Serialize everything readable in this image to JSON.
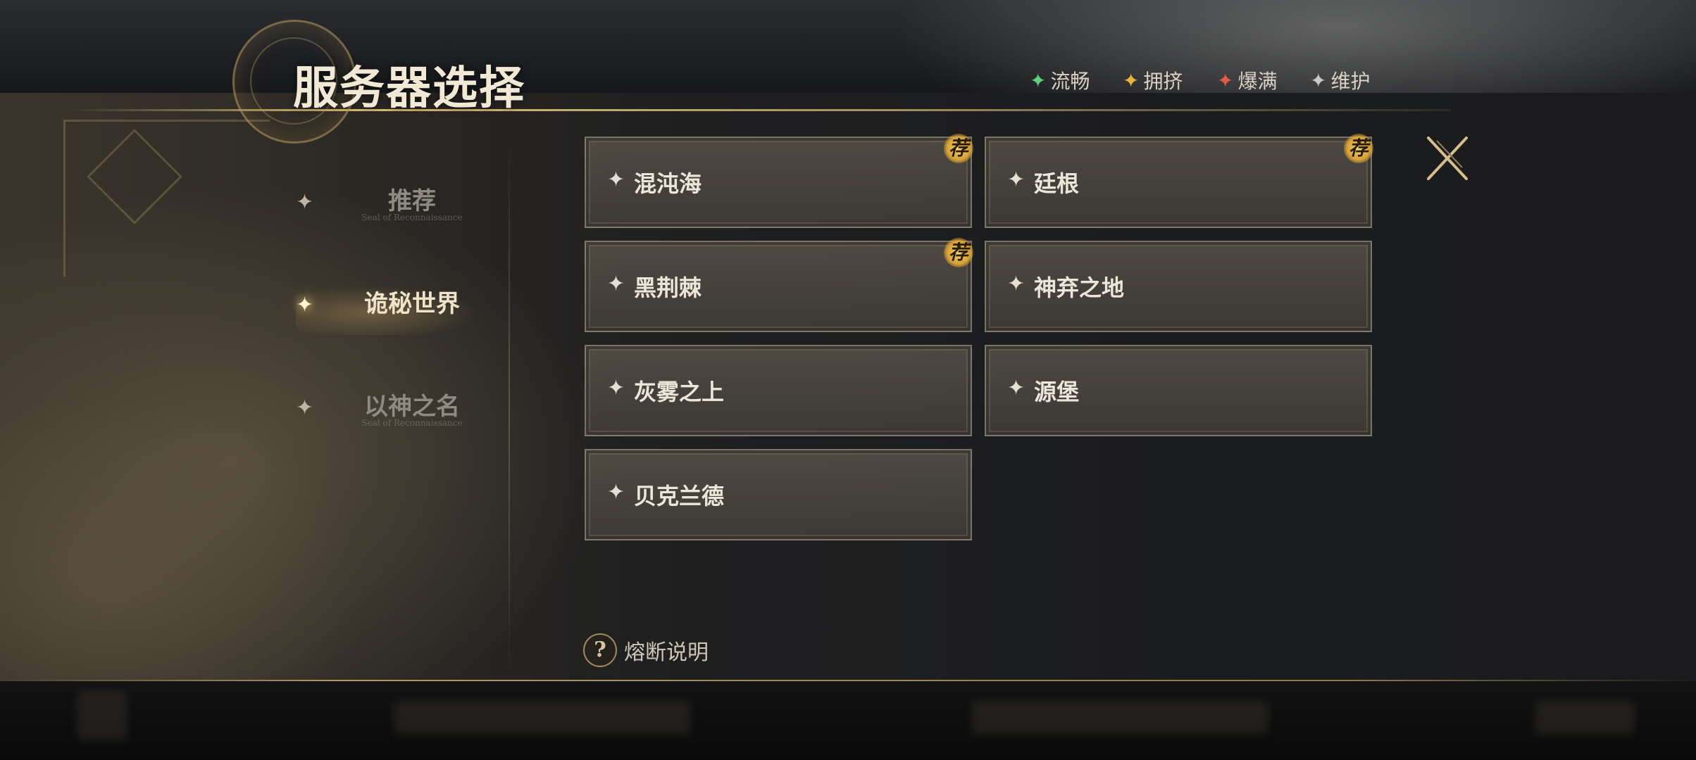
{
  "header": {
    "title": "服务器选择"
  },
  "legend": [
    {
      "label": "流畅",
      "color": "#5fd07a",
      "icon": "star-icon"
    },
    {
      "label": "拥挤",
      "color": "#e8b43d",
      "icon": "star-icon"
    },
    {
      "label": "爆满",
      "color": "#e25a4a",
      "icon": "star-icon"
    },
    {
      "label": "维护",
      "color": "#c8c8c8",
      "icon": "star-icon"
    }
  ],
  "categories": [
    {
      "label": "推荐",
      "sub": "Seal of Reconnaissance",
      "active": false
    },
    {
      "label": "诡秘世界",
      "sub": "",
      "active": true
    },
    {
      "label": "以神之名",
      "sub": "Seal of Reconnaissance",
      "active": false
    }
  ],
  "servers": [
    {
      "name": "混沌海",
      "recommended": true,
      "badge": "荐"
    },
    {
      "name": "廷根",
      "recommended": true,
      "badge": "荐"
    },
    {
      "name": "黑荆棘",
      "recommended": true,
      "badge": "荐"
    },
    {
      "name": "神弃之地",
      "recommended": false,
      "badge": ""
    },
    {
      "name": "灰雾之上",
      "recommended": false,
      "badge": ""
    },
    {
      "name": "源堡",
      "recommended": false,
      "badge": ""
    },
    {
      "name": "贝克兰德",
      "recommended": false,
      "badge": ""
    }
  ],
  "help": {
    "icon": "question-icon",
    "label": "熔断说明"
  },
  "close": {
    "icon": "close-icon"
  }
}
